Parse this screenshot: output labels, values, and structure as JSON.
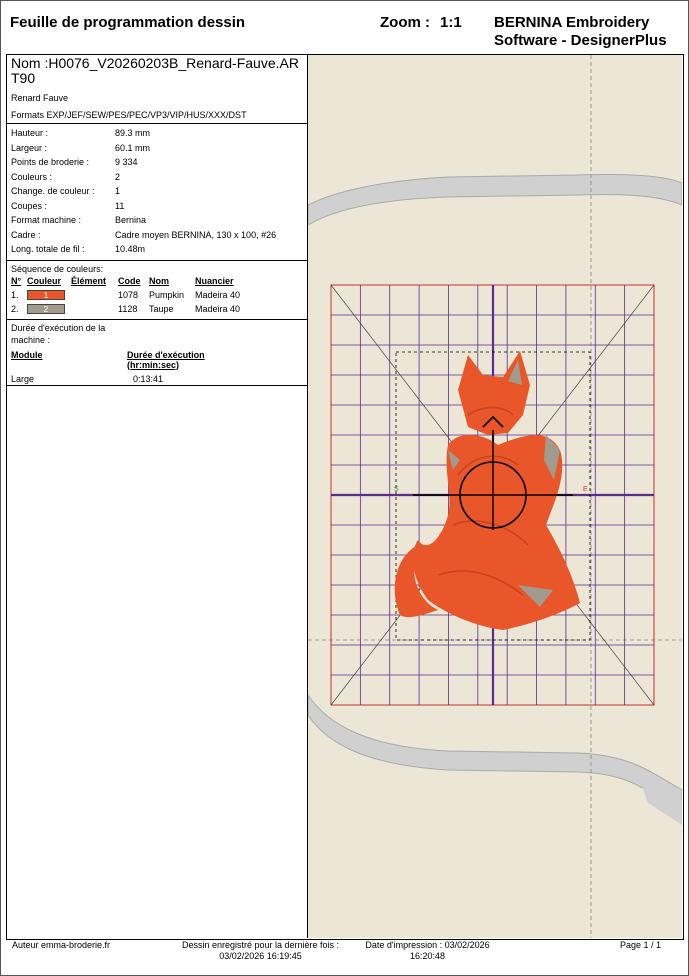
{
  "header": {
    "title": "Feuille de programmation dessin",
    "zoom_label": "Zoom :",
    "zoom_value": "1:1",
    "brand_line1": "BERNINA Embroidery",
    "brand_line2": "Software - DesignerPlus"
  },
  "design": {
    "name": "Nom :H0076_V20260203B_Renard-Fauve.ART90",
    "title": "Renard Fauve",
    "formats": "Formats EXP/JEF/SEW/PES/PEC/VP3/VIP/HUS/XXX/DST"
  },
  "properties": [
    {
      "label": "Hauteur :",
      "value": "89.3 mm"
    },
    {
      "label": "Largeur :",
      "value": "60.1 mm"
    },
    {
      "label": "Points de broderie :",
      "value": "9 334"
    },
    {
      "label": "Couleurs :",
      "value": "2"
    },
    {
      "label": "Change. de couleur :",
      "value": "1"
    },
    {
      "label": "Coupes :",
      "value": "11"
    },
    {
      "label": "Format machine :",
      "value": "Bernina"
    },
    {
      "label": "Cadre :",
      "value": "Cadre moyen BERNINA, 130 x 100, #26"
    },
    {
      "label": "Long. totale de fil :",
      "value": "10.48m"
    }
  ],
  "color_sequence": {
    "title": "Séquence de couleurs:",
    "headers": {
      "no": "N°",
      "color": "Couleur",
      "element": "Élément",
      "code": "Code",
      "name": "Nom",
      "chart": "Nuancier"
    },
    "rows": [
      {
        "no": "1.",
        "swatch": "1",
        "swatch_color": "#e8562a",
        "code": "1078",
        "name": "Pumpkin",
        "chart": "Madeira 40"
      },
      {
        "no": "2.",
        "swatch": "2",
        "swatch_color": "#a29a8d",
        "code": "1128",
        "name": "Taupe",
        "chart": "Madeira 40"
      }
    ]
  },
  "runtime": {
    "title": "Durée d'exécution de la machine :",
    "module_header": "Module",
    "duration_header": "Durée d'exécution (hr:min:sec)",
    "module": "Large",
    "duration": "0:13:41"
  },
  "footer": {
    "author": "Auteur emma-broderie.fr",
    "saved": "Dessin enregistré pour la dernière fois : 03/02/2026 16:19:45",
    "printed": "Date d'impression : 03/02/2026 16:20:48",
    "page": "Page 1 / 1"
  },
  "colors": {
    "thread1": "#e8562a",
    "thread2": "#a29a8d",
    "grid": "#5b2d8c",
    "hoop_area": "#c9302c",
    "fabric": "#ebe6d5"
  }
}
